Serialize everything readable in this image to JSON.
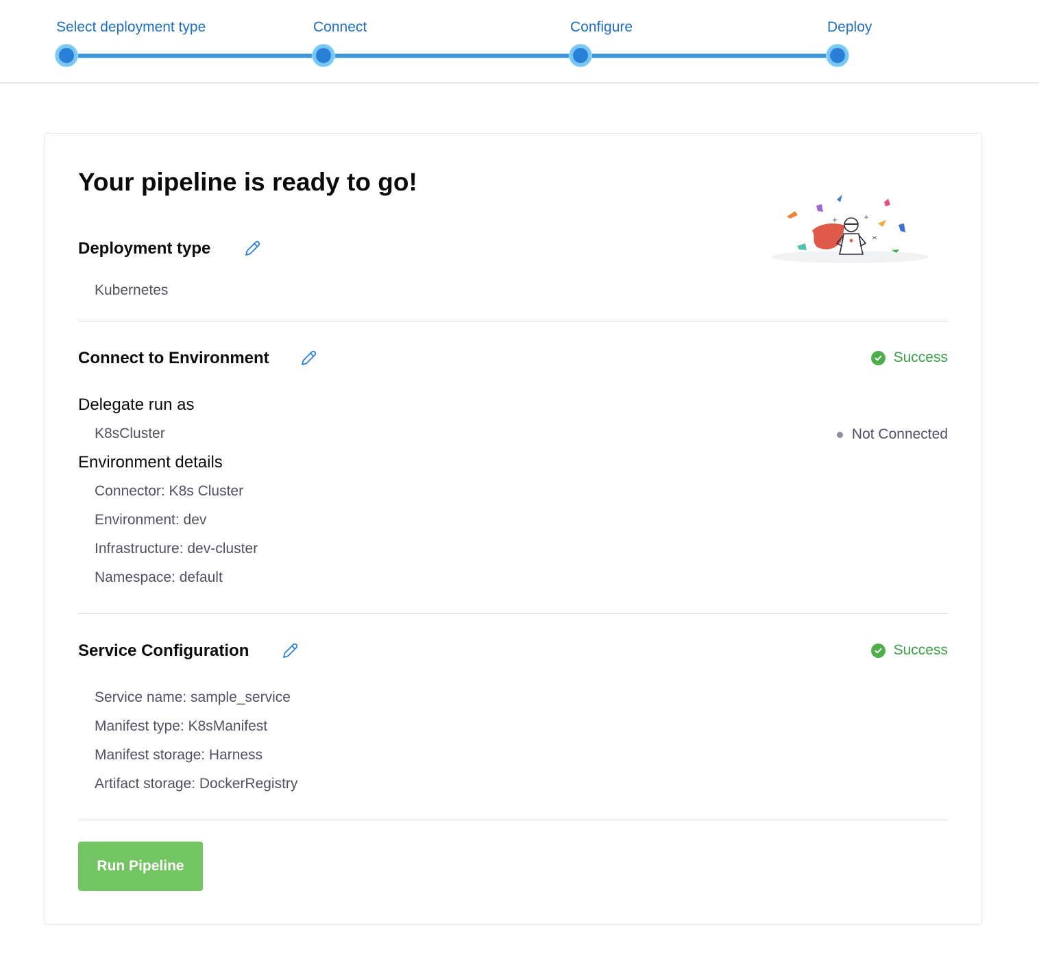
{
  "stepper": {
    "steps": [
      {
        "label": "Select deployment type"
      },
      {
        "label": "Connect"
      },
      {
        "label": "Configure"
      },
      {
        "label": "Deploy"
      }
    ]
  },
  "page": {
    "title": "Your pipeline is ready to go!"
  },
  "deployment_type": {
    "title": "Deployment type",
    "value": "Kubernetes"
  },
  "connect_environment": {
    "title": "Connect to Environment",
    "status": "Success",
    "delegate_heading": "Delegate run as",
    "delegate_value": "K8sCluster",
    "delegate_status": "Not Connected",
    "env_heading": "Environment details",
    "details": [
      "Connector: K8s Cluster",
      "Environment: dev",
      "Infrastructure: dev-cluster",
      "Namespace: default"
    ]
  },
  "service_configuration": {
    "title": "Service Configuration",
    "status": "Success",
    "details": [
      "Service name: sample_service",
      "Manifest type: K8sManifest",
      "Manifest storage: Harness",
      "Artifact storage: DockerRegistry"
    ]
  },
  "actions": {
    "run_label": "Run Pipeline"
  },
  "colors": {
    "accent": "#1f70c1",
    "success": "#3ba146",
    "run_button": "#72c562",
    "muted_text": "#4f5162"
  },
  "icons": [
    "pencil-icon",
    "check-circle-icon",
    "status-dot-icon",
    "celebration-illustration"
  ]
}
